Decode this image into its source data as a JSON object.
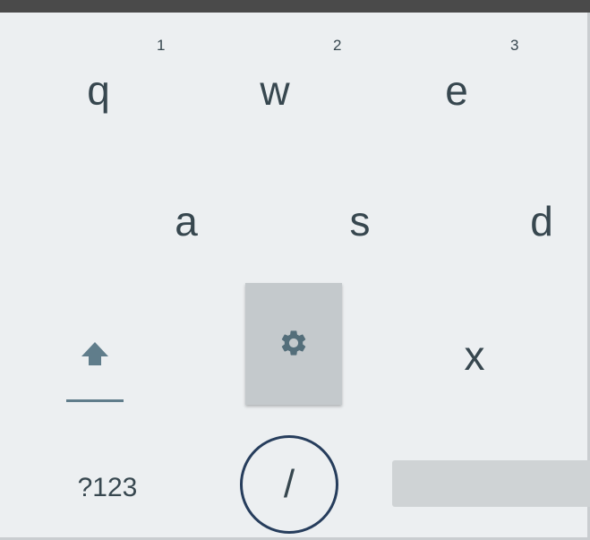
{
  "keyboard": {
    "row1": {
      "keys": [
        {
          "label": "q",
          "hint": "1"
        },
        {
          "label": "w",
          "hint": "2"
        },
        {
          "label": "e",
          "hint": "3"
        }
      ]
    },
    "row2": {
      "keys": [
        {
          "label": "a"
        },
        {
          "label": "s"
        },
        {
          "label": "d"
        }
      ]
    },
    "row3": {
      "shift_icon": "shift-arrow-icon",
      "settings_icon": "gear-icon",
      "x_label": "x"
    },
    "row4": {
      "symbols_label": "?123",
      "slash_label": "/",
      "space_label": ""
    }
  },
  "colors": {
    "background": "#eceff1",
    "key_text": "#37474f",
    "highlight_circle": "#263d5c",
    "settings_key_bg": "#c4c9cc",
    "space_bar": "#cfd3d5"
  }
}
